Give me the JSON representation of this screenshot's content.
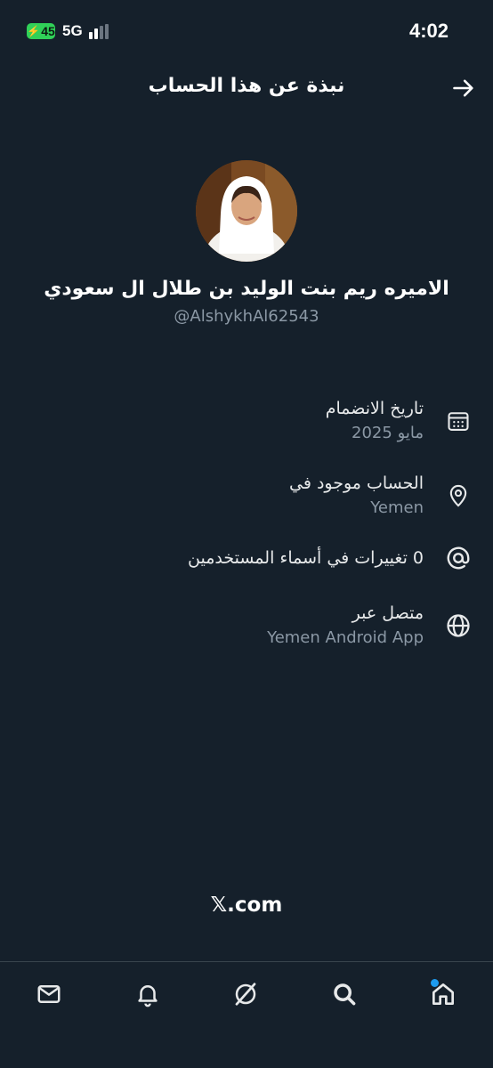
{
  "status_bar": {
    "battery": "45",
    "network": "5G",
    "time": "4:02"
  },
  "header": {
    "title": "نبذة عن هذا الحساب",
    "back_icon": "arrow-right-icon"
  },
  "profile": {
    "display_name": "الاميره ريم بنت الوليد بن طلال ال سعودي",
    "handle": "@AlshykhAl62543"
  },
  "info": {
    "joined": {
      "title": "تاريخ الانضمام",
      "value": "مايو 2025",
      "icon": "calendar-icon"
    },
    "location": {
      "title": "الحساب موجود في",
      "value": "Yemen",
      "icon": "location-pin-icon"
    },
    "username_changes": {
      "title": "0 تغييرات في أسماء المستخدمين",
      "icon": "at-sign-icon"
    },
    "connected_via": {
      "title": "متصل عبر",
      "value": "Yemen Android App",
      "icon": "globe-icon"
    }
  },
  "footer": {
    "x_link": "𝕏.com"
  },
  "bottom_nav": {
    "items": [
      "mail-icon",
      "bell-icon",
      "grok-icon",
      "search-icon",
      "home-icon"
    ]
  },
  "colors": {
    "background": "#15202b",
    "secondary_text": "#8b98a5",
    "accent": "#1d9bf0",
    "battery": "#30d158"
  }
}
